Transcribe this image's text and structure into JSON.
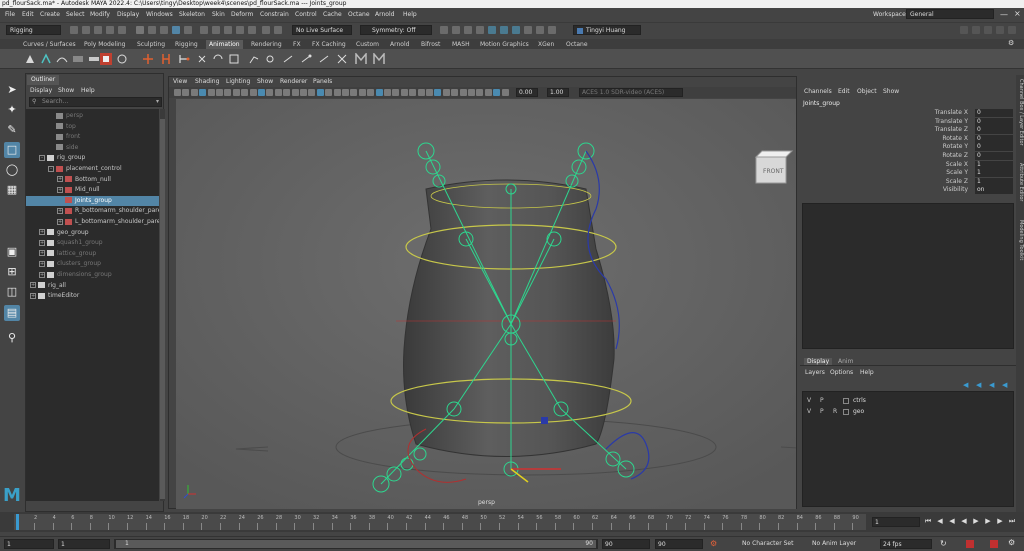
{
  "title_bar": "pd_flourSack.ma* - Autodesk MAYA 2022.4: C:\\Users\\tingy\\Desktop\\week4\\scenes\\pd_flourSack.ma --- Joints_group",
  "menu": [
    "File",
    "Edit",
    "Create",
    "Select",
    "Modify",
    "Display",
    "Windows",
    "Skeleton",
    "Skin",
    "Deform",
    "Constrain",
    "Control",
    "Cache",
    "Octane",
    "Arnold",
    "Help"
  ],
  "workspace": {
    "label": "Workspace:",
    "value": "General"
  },
  "status_line": {
    "menu_set": "Rigging",
    "live_surface": "No Live Surface",
    "symmetry": "Symmetry: Off",
    "user": "Tingyi Huang"
  },
  "shelf_tabs": [
    "Curves / Surfaces",
    "Poly Modeling",
    "Sculpting",
    "Rigging",
    "Animation",
    "Rendering",
    "FX",
    "FX Caching",
    "Custom",
    "Arnold",
    "Bifrost",
    "MASH",
    "Motion Graphics",
    "XGen",
    "Octane"
  ],
  "active_shelf_tab": "Animation",
  "outliner": {
    "tab": "Outliner",
    "menu": [
      "Display",
      "Show",
      "Help"
    ],
    "search_placeholder": "Search...",
    "rows": [
      {
        "label": "persp",
        "indent": 2,
        "type": "camera",
        "dim": true
      },
      {
        "label": "top",
        "indent": 2,
        "type": "camera",
        "dim": true
      },
      {
        "label": "front",
        "indent": 2,
        "type": "camera",
        "dim": true
      },
      {
        "label": "side",
        "indent": 2,
        "type": "camera",
        "dim": true
      },
      {
        "label": "rig_group",
        "indent": 1,
        "type": "group",
        "expand": "-"
      },
      {
        "label": "placement_control",
        "indent": 2,
        "type": "curve",
        "expand": "-"
      },
      {
        "label": "Bottom_null",
        "indent": 3,
        "type": "null",
        "expand": "+"
      },
      {
        "label": "Mid_null",
        "indent": 3,
        "type": "null",
        "expand": "+"
      },
      {
        "label": "Joints_group",
        "indent": 3,
        "type": "null",
        "selected": true
      },
      {
        "label": "R_bottomarm_shoulder_parent_null",
        "indent": 3,
        "type": "null",
        "expand": "+"
      },
      {
        "label": "L_bottomarm_shoulder_parent_null",
        "indent": 3,
        "type": "null",
        "expand": "+"
      },
      {
        "label": "geo_group",
        "indent": 1,
        "type": "group",
        "expand": "+"
      },
      {
        "label": "squash1_group",
        "indent": 1,
        "type": "group",
        "expand": "+",
        "dim": true
      },
      {
        "label": "lattice_group",
        "indent": 1,
        "type": "group",
        "expand": "+",
        "dim": true
      },
      {
        "label": "clusters_group",
        "indent": 1,
        "type": "group",
        "expand": "+",
        "dim": true
      },
      {
        "label": "dimensions_group",
        "indent": 1,
        "type": "group",
        "expand": "+",
        "dim": true
      },
      {
        "label": "rig_all",
        "indent": 0,
        "type": "group",
        "expand": "+"
      },
      {
        "label": "timeEditor",
        "indent": 0,
        "type": "group",
        "expand": "+"
      }
    ]
  },
  "viewport": {
    "menu": [
      "View",
      "Shading",
      "Lighting",
      "Show",
      "Renderer",
      "Panels"
    ],
    "exposure": "0.00",
    "gamma": "1.00",
    "colorspace": "ACES 1.0 SDR-video (ACES)",
    "camera_label": "persp",
    "cube_label": "FRONT"
  },
  "channel_box": {
    "menu": [
      "Channels",
      "Edit",
      "Object",
      "Show"
    ],
    "object": "Joints_group",
    "channels": [
      {
        "name": "Translate X",
        "value": "0"
      },
      {
        "name": "Translate Y",
        "value": "0"
      },
      {
        "name": "Translate Z",
        "value": "0"
      },
      {
        "name": "Rotate X",
        "value": "0"
      },
      {
        "name": "Rotate Y",
        "value": "0"
      },
      {
        "name": "Rotate Z",
        "value": "0"
      },
      {
        "name": "Scale X",
        "value": "1"
      },
      {
        "name": "Scale Y",
        "value": "1"
      },
      {
        "name": "Scale Z",
        "value": "1"
      },
      {
        "name": "Visibility",
        "value": "on"
      }
    ]
  },
  "layer_editor": {
    "tabs": [
      "Display",
      "Anim"
    ],
    "menu": [
      "Layers",
      "Options",
      "Help"
    ],
    "layers": [
      {
        "v": "V",
        "p": "P",
        "r": "",
        "name": "ctrls"
      },
      {
        "v": "V",
        "p": "P",
        "r": "R",
        "name": "geo"
      }
    ]
  },
  "side_tabs": [
    "Channel Box / Layer Editor",
    "Attribute Editor",
    "Modeling Toolkit"
  ],
  "timeline": {
    "ticks": [
      "2",
      "4",
      "6",
      "8",
      "10",
      "12",
      "14",
      "16",
      "18",
      "20",
      "22",
      "24",
      "26",
      "28",
      "30",
      "32",
      "34",
      "36",
      "38",
      "40",
      "42",
      "44",
      "46",
      "48",
      "50",
      "52",
      "54",
      "56",
      "58",
      "60",
      "62",
      "64",
      "66",
      "68",
      "70",
      "72",
      "74",
      "76",
      "78",
      "80",
      "82",
      "84",
      "86",
      "88",
      "90"
    ],
    "current_frame": "1"
  },
  "range": {
    "start": "1",
    "anim_start": "1",
    "range_start": "1",
    "range_end": "90",
    "end": "90",
    "anim_end": "90",
    "character_set": "No Character Set",
    "anim_layer": "No Anim Layer",
    "fps": "24 fps"
  }
}
